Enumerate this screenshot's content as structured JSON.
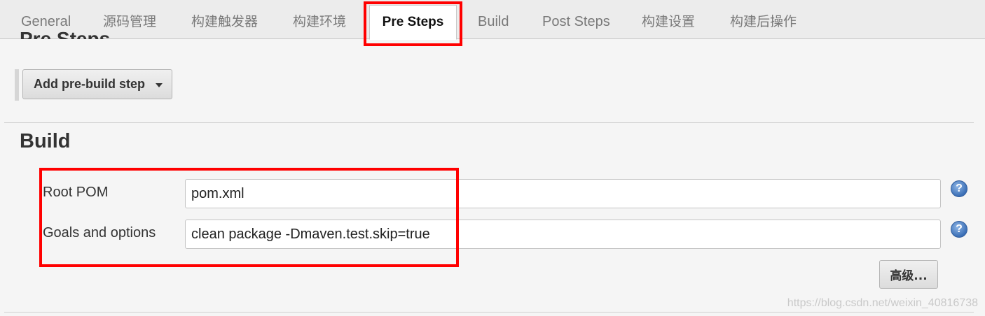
{
  "tabs": [
    {
      "label": "General"
    },
    {
      "label": "源码管理"
    },
    {
      "label": "构建触发器"
    },
    {
      "label": "构建环境"
    },
    {
      "label": "Pre Steps",
      "active": true
    },
    {
      "label": "Build"
    },
    {
      "label": "Post Steps"
    },
    {
      "label": "构建设置"
    },
    {
      "label": "构建后操作"
    }
  ],
  "pre_steps": {
    "cut_heading": "Pre Steps",
    "add_button_label": "Add pre-build step"
  },
  "build": {
    "title": "Build",
    "fields": [
      {
        "label": "Root POM",
        "value": "pom.xml"
      },
      {
        "label": "Goals and options",
        "value": "clean package -Dmaven.test.skip=true"
      }
    ],
    "advanced_button": "高级..."
  },
  "watermark": "https://blog.csdn.net/weixin_40816738",
  "colors": {
    "highlight": "#ff0000",
    "help_icon": "#3b6fb6"
  }
}
